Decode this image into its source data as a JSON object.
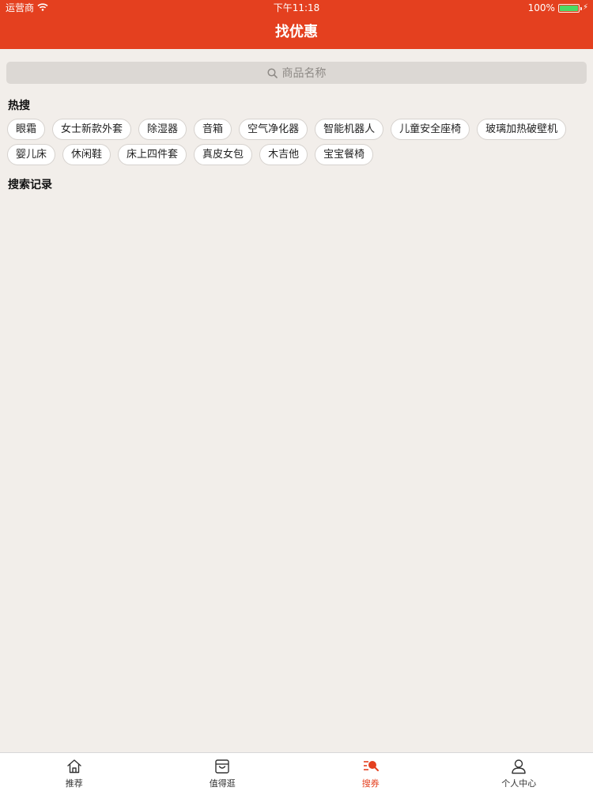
{
  "status_bar": {
    "carrier": "运营商",
    "time": "下午11:18",
    "battery": "100%"
  },
  "nav": {
    "title": "找优惠"
  },
  "search": {
    "placeholder": "商品名称"
  },
  "hot_search": {
    "title": "热搜",
    "tags_row1": [
      "眼霜",
      "女士新款外套",
      "除湿器",
      "音箱",
      "空气净化器",
      "智能机器人",
      "儿童安全座椅",
      "玻璃加热破壁机"
    ],
    "tags_row2": [
      "婴儿床",
      "休闲鞋",
      "床上四件套",
      "真皮女包",
      "木吉他",
      "宝宝餐椅"
    ]
  },
  "history": {
    "title": "搜索记录"
  },
  "tab_bar": {
    "tabs": [
      {
        "label": "推荐",
        "icon": "home-icon"
      },
      {
        "label": "值得逛",
        "icon": "shopping-box-icon"
      },
      {
        "label": "搜券",
        "icon": "search-coupon-icon"
      },
      {
        "label": "个人中心",
        "icon": "user-icon"
      }
    ],
    "active_index": 2
  },
  "colors": {
    "brand": "#e4401f",
    "background": "#f2eeea",
    "battery": "#4cd964"
  }
}
